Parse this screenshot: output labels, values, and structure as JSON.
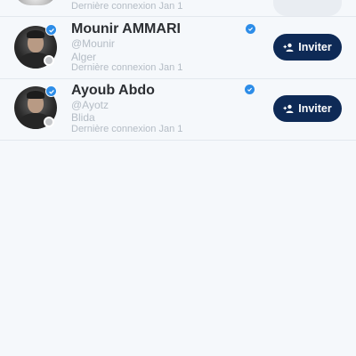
{
  "list": {
    "partial_row": {
      "last_seen": "Dernière connexion Jan 1"
    },
    "users": [
      {
        "name": "Mounir AMMARI",
        "handle": "@Mounir",
        "city": "Alger",
        "last_seen": "Dernière connexion Jan 1",
        "button_label": "Inviter"
      },
      {
        "name": "Ayoub Abdo",
        "handle": "@Ayotz",
        "city": "Blida",
        "last_seen": "Dernière connexion Jan 1",
        "button_label": "Inviter"
      }
    ]
  },
  "colors": {
    "background": "#f5f8fb",
    "button": "#0e2a56",
    "verified": "#2d8de8",
    "offline_dot": "#c7c9cc"
  },
  "icons": {
    "verified": "verified-check-icon",
    "add_user": "add-user-icon",
    "status": "offline-status-icon"
  }
}
